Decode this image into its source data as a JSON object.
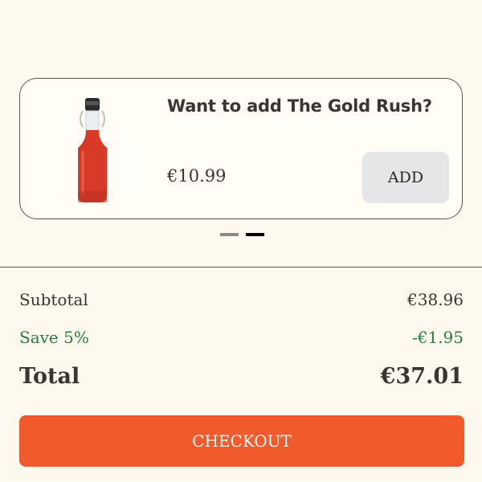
{
  "upsell": {
    "title": "Want to add The Gold Rush?",
    "price": "€10.99",
    "add_label": "ADD",
    "image_icon": "bottle-image"
  },
  "carousel": {
    "pages": 2,
    "active_index": 1
  },
  "summary": {
    "subtotal_label": "Subtotal",
    "subtotal_value": "€38.96",
    "discount_label": "Save 5%",
    "discount_value": "-€1.95",
    "total_label": "Total",
    "total_value": "€37.01"
  },
  "checkout": {
    "label": "CHECKOUT"
  },
  "colors": {
    "background": "#fdf9ee",
    "accent": "#f15a2b",
    "discount": "#2f7a3d",
    "add_button": "#e5e6e8"
  }
}
